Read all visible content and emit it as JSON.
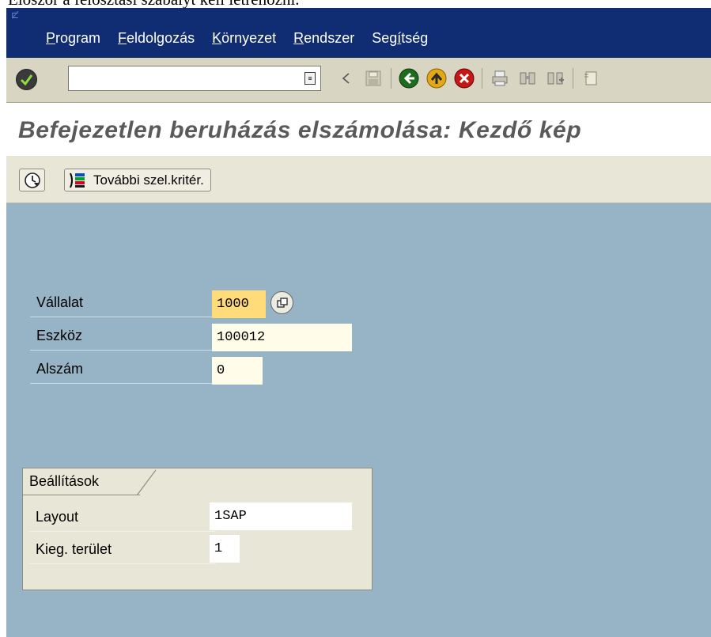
{
  "top_note": "Először a felosztási szabályt kell létrehozni.",
  "menu": {
    "items": [
      {
        "pre": "",
        "key": "P",
        "rest": "rogram"
      },
      {
        "pre": "",
        "key": "F",
        "rest": "eldolgozás"
      },
      {
        "pre": "",
        "key": "K",
        "rest": "örnyezet"
      },
      {
        "pre": "",
        "key": "R",
        "rest": "endszer"
      },
      {
        "pre": "Seg",
        "key": "í",
        "rest": "tség"
      }
    ]
  },
  "toolbar": {
    "command_field_value": "",
    "icons": [
      "enter-icon",
      "back-arrow-icon",
      "save-icon",
      "back-icon",
      "exit-icon",
      "cancel-icon",
      "print-icon",
      "find-icon",
      "find-next-icon",
      "first-page-icon"
    ]
  },
  "title": "Befejezetlen beruházás elszámolása: Kezdő kép",
  "app_toolbar": {
    "more_criteria_label": "További szel.kritér."
  },
  "form": {
    "company_label": "Vállalat",
    "company_value": "1000",
    "asset_label": "Eszköz",
    "asset_value": "100012",
    "subnumber_label": "Alszám",
    "subnumber_value": "0"
  },
  "settings": {
    "title": "Beállítások",
    "layout_label": "Layout",
    "layout_value": "1SAP",
    "supp_area_label": "Kieg. terület",
    "supp_area_value": "1"
  },
  "colors": {
    "menubar": "#102d73",
    "toolbar": "#d9d5c3",
    "workarea": "#97b4c6",
    "field": "#fffde9",
    "active_field": "#ffdb7a"
  }
}
